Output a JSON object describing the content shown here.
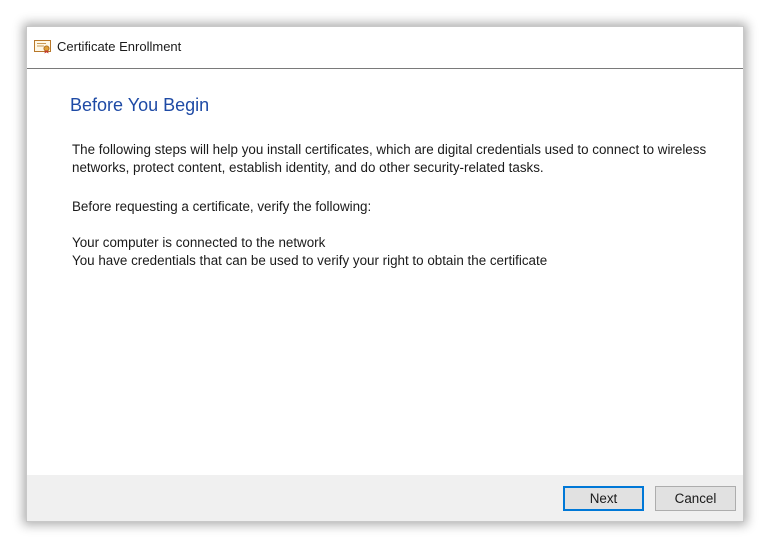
{
  "window": {
    "title": "Certificate Enrollment",
    "icon": "certificate-icon"
  },
  "content": {
    "heading": "Before You Begin",
    "intro": "The following steps will help you install certificates, which are digital credentials used to connect to wireless networks, protect content, establish identity, and do other security-related tasks.",
    "verify_prompt": "Before requesting a certificate, verify the following:",
    "requirements": [
      "Your computer is connected to the network",
      "You have credentials that can be used to verify your right to obtain the certificate"
    ]
  },
  "footer": {
    "next_label": "Next",
    "cancel_label": "Cancel"
  },
  "colors": {
    "heading": "#1e4aa5",
    "footer_bg": "#f0f0f0",
    "default_button_border": "#0078d7"
  }
}
